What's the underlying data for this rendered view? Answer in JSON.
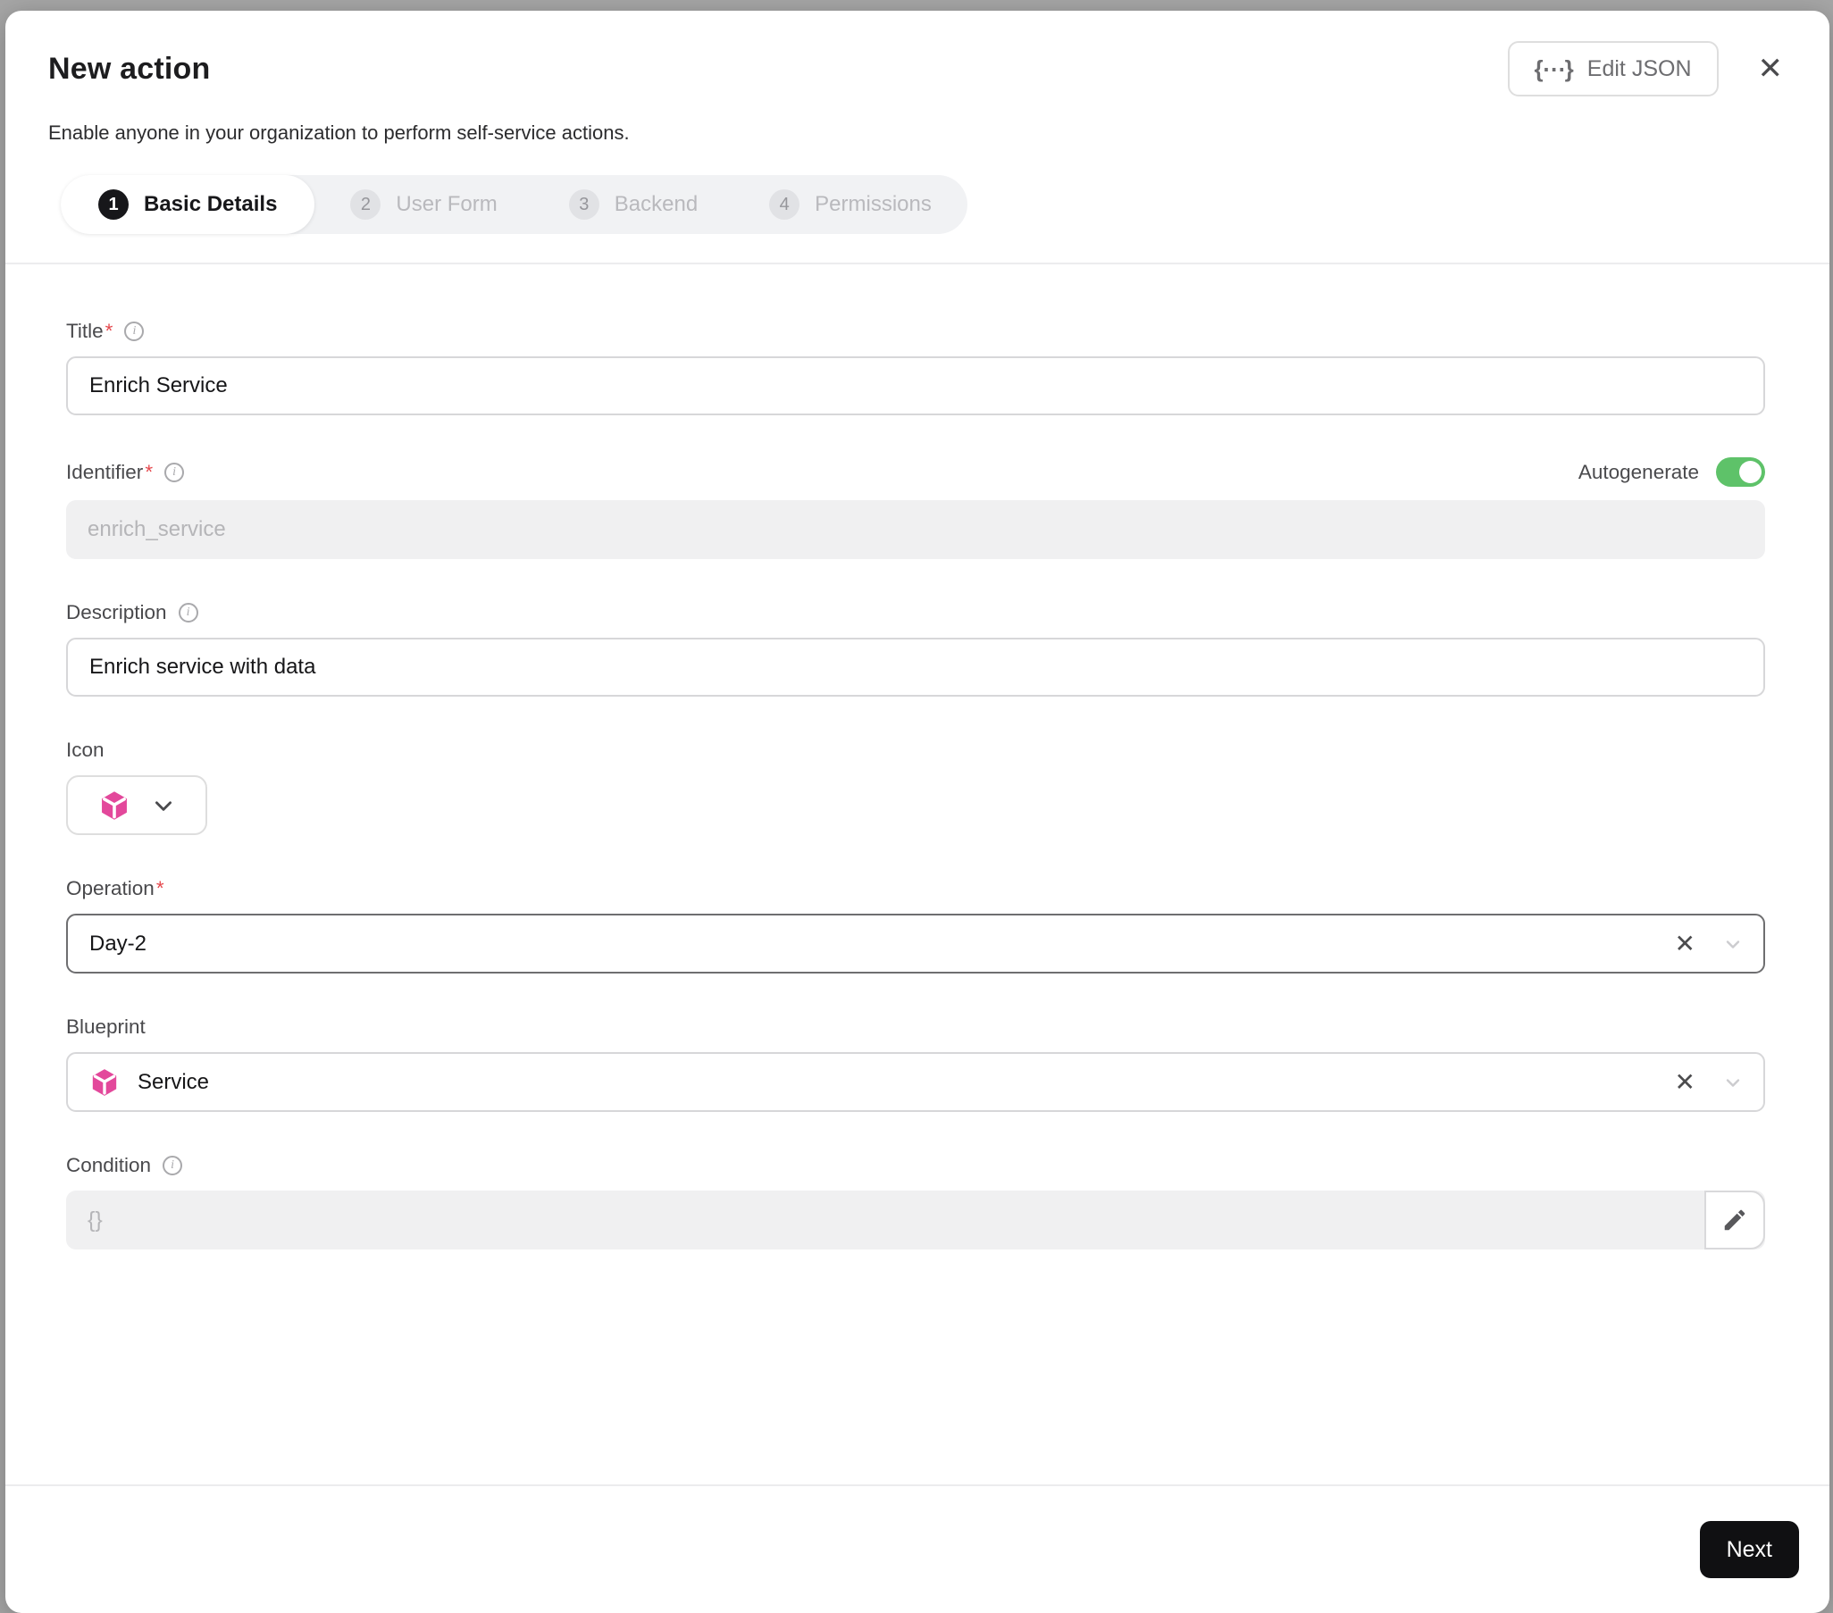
{
  "modal": {
    "title": "New action",
    "subtitle": "Enable anyone in your organization to perform self-service actions.",
    "edit_json_label": "Edit JSON",
    "edit_json_icon": "{⋯}",
    "close_icon": "✕"
  },
  "stepper": {
    "steps": [
      {
        "number": "1",
        "label": "Basic Details",
        "active": true
      },
      {
        "number": "2",
        "label": "User Form",
        "active": false
      },
      {
        "number": "3",
        "label": "Backend",
        "active": false
      },
      {
        "number": "4",
        "label": "Permissions",
        "active": false
      }
    ]
  },
  "form": {
    "title": {
      "label": "Title",
      "required": "*",
      "value": "Enrich Service"
    },
    "identifier": {
      "label": "Identifier",
      "required": "*",
      "value": "enrich_service",
      "disabled": true,
      "toggle_label": "Autogenerate",
      "toggle_state": "on"
    },
    "description": {
      "label": "Description",
      "value": "Enrich service with data"
    },
    "icon": {
      "label": "Icon",
      "selected_icon": "pink-cube"
    },
    "operation": {
      "label": "Operation",
      "required": "*",
      "value": "Day-2",
      "clear_icon": "✕"
    },
    "blueprint": {
      "label": "Blueprint",
      "value": "Service",
      "icon": "pink-cube",
      "clear_icon": "✕"
    },
    "condition": {
      "label": "Condition",
      "placeholder": "{}",
      "disabled": true
    }
  },
  "footer": {
    "next_label": "Next"
  },
  "colors": {
    "accent_pink": "#e3489b",
    "toggle_green": "#5ec269",
    "primary_button": "#101012",
    "required_red": "#e5484d",
    "disabled_bg": "#f0f0f1"
  }
}
